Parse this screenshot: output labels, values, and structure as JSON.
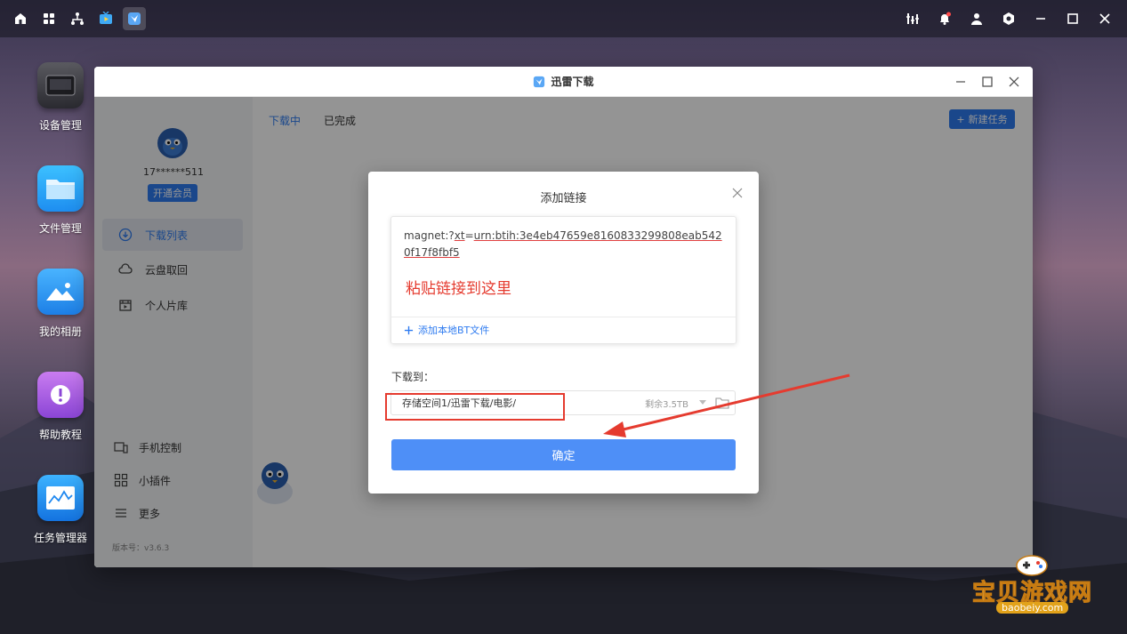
{
  "taskbar": {
    "left_icons": [
      "home-icon",
      "apps-grid-icon",
      "network-icon",
      "tv-icon",
      "thunder-app-icon"
    ],
    "right_icons": [
      "equalizer-icon",
      "bell-icon",
      "user-icon",
      "settings-icon",
      "minimize-icon",
      "maximize-icon",
      "close-icon"
    ]
  },
  "desktop": {
    "icons": [
      {
        "label": "设备管理",
        "icon": "device-icon"
      },
      {
        "label": "文件管理",
        "icon": "folder-icon"
      },
      {
        "label": "我的相册",
        "icon": "photo-icon"
      },
      {
        "label": "帮助教程",
        "icon": "help-icon"
      },
      {
        "label": "任务管理器",
        "icon": "task-manager-icon"
      }
    ]
  },
  "window": {
    "title": "迅雷下载",
    "user": {
      "name": "17******511",
      "vip_label": "开通会员"
    },
    "nav": [
      {
        "label": "下载列表",
        "icon": "download-icon",
        "active": true
      },
      {
        "label": "云盘取回",
        "icon": "cloud-icon",
        "active": false
      },
      {
        "label": "个人片库",
        "icon": "film-icon",
        "active": false
      }
    ],
    "bottom_nav": [
      {
        "label": "手机控制",
        "icon": "phone-icon"
      },
      {
        "label": "小插件",
        "icon": "plugin-icon"
      },
      {
        "label": "更多",
        "icon": "menu-icon"
      }
    ],
    "version": "版本号：v3.6.3",
    "tabs": [
      "下载中",
      "已完成"
    ],
    "new_task_label": "新建任务"
  },
  "dialog": {
    "title": "添加链接",
    "link_prefix": "magnet:?",
    "link_underlined": "xt",
    "link_eq": "=",
    "link_rest": "urn:btih:3e4eb47659e8160833299808eab5420f17f8fbf5",
    "paste_hint": "粘贴链接到这里",
    "add_bt_label": "添加本地BT文件",
    "download_to_label": "下载到：",
    "path": "存储空间1/迅雷下载/电影/",
    "free_space": "剩余3.5TB",
    "confirm_label": "确定"
  },
  "watermark": {
    "main": "宝贝游戏网",
    "sub": "baobeiy.com"
  },
  "colors": {
    "accent": "#2e7bf0",
    "button": "#4e8ff7",
    "highlight_red": "#e53b2f"
  }
}
